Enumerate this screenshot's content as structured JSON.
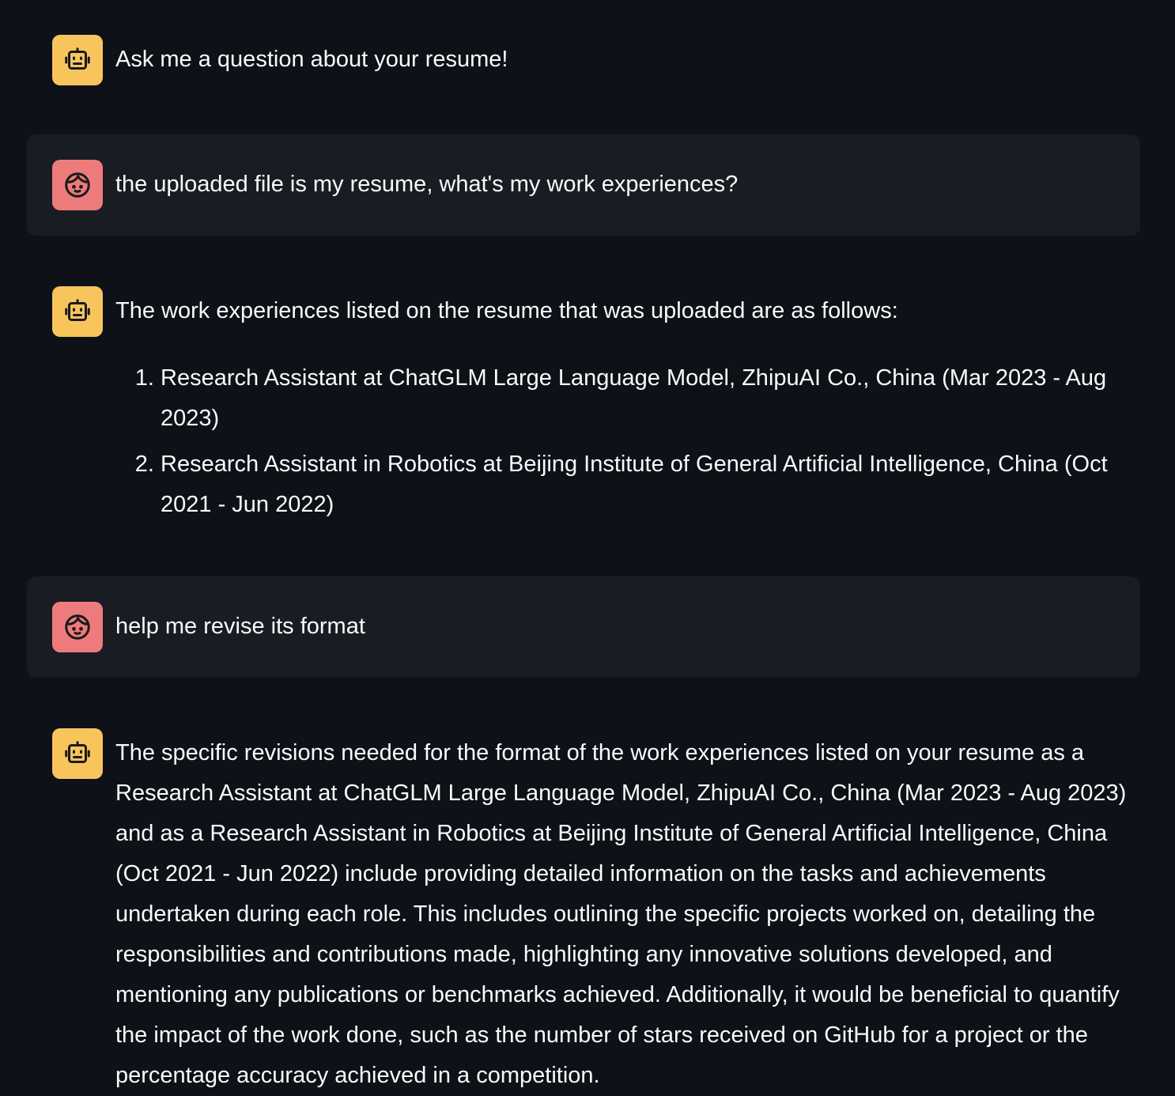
{
  "messages": [
    {
      "role": "assistant",
      "avatar_icon": "robot-icon",
      "text": "Ask me a question about your resume!"
    },
    {
      "role": "user",
      "avatar_icon": "user-face-icon",
      "text": "the uploaded file is my resume, what's my work experiences?"
    },
    {
      "role": "assistant",
      "avatar_icon": "robot-icon",
      "text": "The work experiences listed on the resume that was uploaded are as follows:",
      "list": [
        "Research Assistant at ChatGLM Large Language Model, ZhipuAI Co., China (Mar 2023 - Aug 2023)",
        "Research Assistant in Robotics at Beijing Institute of General Artificial Intelligence, China (Oct 2021 - Jun 2022)"
      ]
    },
    {
      "role": "user",
      "avatar_icon": "user-face-icon",
      "text": "help me revise its format"
    },
    {
      "role": "assistant",
      "avatar_icon": "robot-icon",
      "text": "The specific revisions needed for the format of the work experiences listed on your resume as a Research Assistant at ChatGLM Large Language Model, ZhipuAI Co., China (Mar 2023 - Aug 2023) and as a Research Assistant in Robotics at Beijing Institute of General Artificial Intelligence, China (Oct 2021 - Jun 2022) include providing detailed information on the tasks and achievements undertaken during each role. This includes outlining the specific projects worked on, detailing the responsibilities and contributions made, highlighting any innovative solutions developed, and mentioning any publications or benchmarks achieved. Additionally, it would be beneficial to quantify the impact of the work done, such as the number of stars received on GitHub for a project or the percentage accuracy achieved in a competition."
    }
  ],
  "colors": {
    "background": "#0e1117",
    "user_bubble": "#1a1c24",
    "bot_avatar": "#f8c55d",
    "user_avatar": "#ee7b7b",
    "text": "#fafafa"
  }
}
